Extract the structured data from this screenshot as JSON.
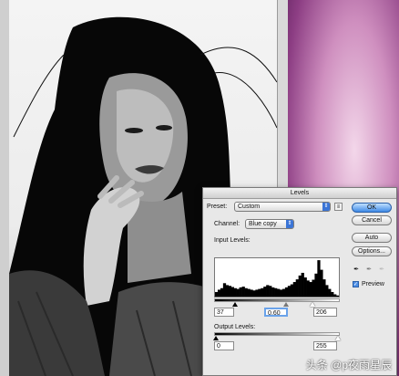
{
  "dialog": {
    "title": "Levels",
    "preset_label": "Preset:",
    "preset_value": "Custom",
    "channel_label": "Channel:",
    "channel_value": "Blue copy",
    "input_levels_label": "Input Levels:",
    "input_black": "37",
    "input_gamma": "0.60",
    "input_white": "206",
    "output_levels_label": "Output Levels:",
    "output_black": "0",
    "output_white": "255",
    "preview_label": "Preview",
    "preview_checked": true
  },
  "buttons": {
    "ok": "OK",
    "cancel": "Cancel",
    "auto": "Auto",
    "options": "Options..."
  },
  "watermark": "头条 @p夜雨星辰",
  "histogram_levels": [
    0.12,
    0.18,
    0.22,
    0.35,
    0.3,
    0.28,
    0.25,
    0.22,
    0.2,
    0.24,
    0.26,
    0.22,
    0.2,
    0.18,
    0.16,
    0.18,
    0.2,
    0.22,
    0.26,
    0.3,
    0.28,
    0.24,
    0.22,
    0.2,
    0.18,
    0.2,
    0.24,
    0.28,
    0.32,
    0.38,
    0.45,
    0.55,
    0.62,
    0.5,
    0.42,
    0.38,
    0.44,
    0.6,
    0.95,
    0.7,
    0.45,
    0.3,
    0.2,
    0.12,
    0.06,
    0.03
  ]
}
